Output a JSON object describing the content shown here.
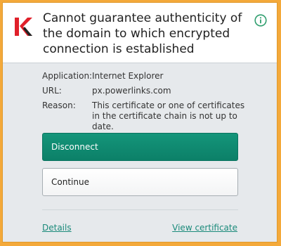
{
  "dialog": {
    "title": "Cannot guarantee authenticity of the domain to which encrypted connection is established"
  },
  "details": [
    {
      "label": "Application:",
      "value": "Internet Explorer"
    },
    {
      "label": "URL:",
      "value": "px.powerlinks.com"
    },
    {
      "label": "Reason:",
      "value": "This certificate or one of certificates in the certificate chain is not up to date."
    }
  ],
  "buttons": {
    "disconnect": "Disconnect",
    "continue": "Continue"
  },
  "links": {
    "details": "Details",
    "view_certificate": "View certificate"
  },
  "icons": {
    "logo": "kaspersky-k-logo",
    "info": "info-icon"
  },
  "colors": {
    "frame": "#f4a93a",
    "primary_button": "#0f8a70",
    "link": "#1a8a7a",
    "logo_red": "#e0202a"
  }
}
